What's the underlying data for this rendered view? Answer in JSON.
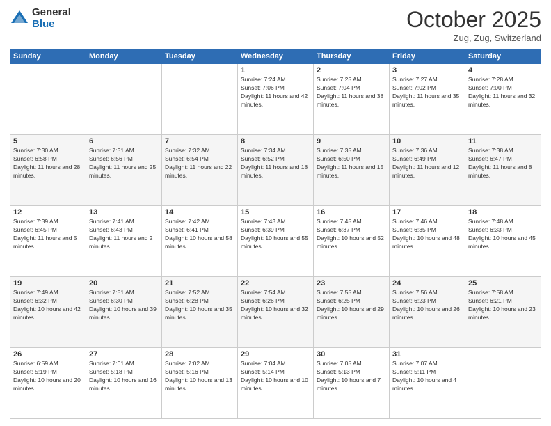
{
  "logo": {
    "general": "General",
    "blue": "Blue"
  },
  "title": "October 2025",
  "location": "Zug, Zug, Switzerland",
  "weekdays": [
    "Sunday",
    "Monday",
    "Tuesday",
    "Wednesday",
    "Thursday",
    "Friday",
    "Saturday"
  ],
  "weeks": [
    [
      {
        "day": "",
        "info": ""
      },
      {
        "day": "",
        "info": ""
      },
      {
        "day": "",
        "info": ""
      },
      {
        "day": "1",
        "info": "Sunrise: 7:24 AM\nSunset: 7:06 PM\nDaylight: 11 hours and 42 minutes."
      },
      {
        "day": "2",
        "info": "Sunrise: 7:25 AM\nSunset: 7:04 PM\nDaylight: 11 hours and 38 minutes."
      },
      {
        "day": "3",
        "info": "Sunrise: 7:27 AM\nSunset: 7:02 PM\nDaylight: 11 hours and 35 minutes."
      },
      {
        "day": "4",
        "info": "Sunrise: 7:28 AM\nSunset: 7:00 PM\nDaylight: 11 hours and 32 minutes."
      }
    ],
    [
      {
        "day": "5",
        "info": "Sunrise: 7:30 AM\nSunset: 6:58 PM\nDaylight: 11 hours and 28 minutes."
      },
      {
        "day": "6",
        "info": "Sunrise: 7:31 AM\nSunset: 6:56 PM\nDaylight: 11 hours and 25 minutes."
      },
      {
        "day": "7",
        "info": "Sunrise: 7:32 AM\nSunset: 6:54 PM\nDaylight: 11 hours and 22 minutes."
      },
      {
        "day": "8",
        "info": "Sunrise: 7:34 AM\nSunset: 6:52 PM\nDaylight: 11 hours and 18 minutes."
      },
      {
        "day": "9",
        "info": "Sunrise: 7:35 AM\nSunset: 6:50 PM\nDaylight: 11 hours and 15 minutes."
      },
      {
        "day": "10",
        "info": "Sunrise: 7:36 AM\nSunset: 6:49 PM\nDaylight: 11 hours and 12 minutes."
      },
      {
        "day": "11",
        "info": "Sunrise: 7:38 AM\nSunset: 6:47 PM\nDaylight: 11 hours and 8 minutes."
      }
    ],
    [
      {
        "day": "12",
        "info": "Sunrise: 7:39 AM\nSunset: 6:45 PM\nDaylight: 11 hours and 5 minutes."
      },
      {
        "day": "13",
        "info": "Sunrise: 7:41 AM\nSunset: 6:43 PM\nDaylight: 11 hours and 2 minutes."
      },
      {
        "day": "14",
        "info": "Sunrise: 7:42 AM\nSunset: 6:41 PM\nDaylight: 10 hours and 58 minutes."
      },
      {
        "day": "15",
        "info": "Sunrise: 7:43 AM\nSunset: 6:39 PM\nDaylight: 10 hours and 55 minutes."
      },
      {
        "day": "16",
        "info": "Sunrise: 7:45 AM\nSunset: 6:37 PM\nDaylight: 10 hours and 52 minutes."
      },
      {
        "day": "17",
        "info": "Sunrise: 7:46 AM\nSunset: 6:35 PM\nDaylight: 10 hours and 48 minutes."
      },
      {
        "day": "18",
        "info": "Sunrise: 7:48 AM\nSunset: 6:33 PM\nDaylight: 10 hours and 45 minutes."
      }
    ],
    [
      {
        "day": "19",
        "info": "Sunrise: 7:49 AM\nSunset: 6:32 PM\nDaylight: 10 hours and 42 minutes."
      },
      {
        "day": "20",
        "info": "Sunrise: 7:51 AM\nSunset: 6:30 PM\nDaylight: 10 hours and 39 minutes."
      },
      {
        "day": "21",
        "info": "Sunrise: 7:52 AM\nSunset: 6:28 PM\nDaylight: 10 hours and 35 minutes."
      },
      {
        "day": "22",
        "info": "Sunrise: 7:54 AM\nSunset: 6:26 PM\nDaylight: 10 hours and 32 minutes."
      },
      {
        "day": "23",
        "info": "Sunrise: 7:55 AM\nSunset: 6:25 PM\nDaylight: 10 hours and 29 minutes."
      },
      {
        "day": "24",
        "info": "Sunrise: 7:56 AM\nSunset: 6:23 PM\nDaylight: 10 hours and 26 minutes."
      },
      {
        "day": "25",
        "info": "Sunrise: 7:58 AM\nSunset: 6:21 PM\nDaylight: 10 hours and 23 minutes."
      }
    ],
    [
      {
        "day": "26",
        "info": "Sunrise: 6:59 AM\nSunset: 5:19 PM\nDaylight: 10 hours and 20 minutes."
      },
      {
        "day": "27",
        "info": "Sunrise: 7:01 AM\nSunset: 5:18 PM\nDaylight: 10 hours and 16 minutes."
      },
      {
        "day": "28",
        "info": "Sunrise: 7:02 AM\nSunset: 5:16 PM\nDaylight: 10 hours and 13 minutes."
      },
      {
        "day": "29",
        "info": "Sunrise: 7:04 AM\nSunset: 5:14 PM\nDaylight: 10 hours and 10 minutes."
      },
      {
        "day": "30",
        "info": "Sunrise: 7:05 AM\nSunset: 5:13 PM\nDaylight: 10 hours and 7 minutes."
      },
      {
        "day": "31",
        "info": "Sunrise: 7:07 AM\nSunset: 5:11 PM\nDaylight: 10 hours and 4 minutes."
      },
      {
        "day": "",
        "info": ""
      }
    ]
  ]
}
